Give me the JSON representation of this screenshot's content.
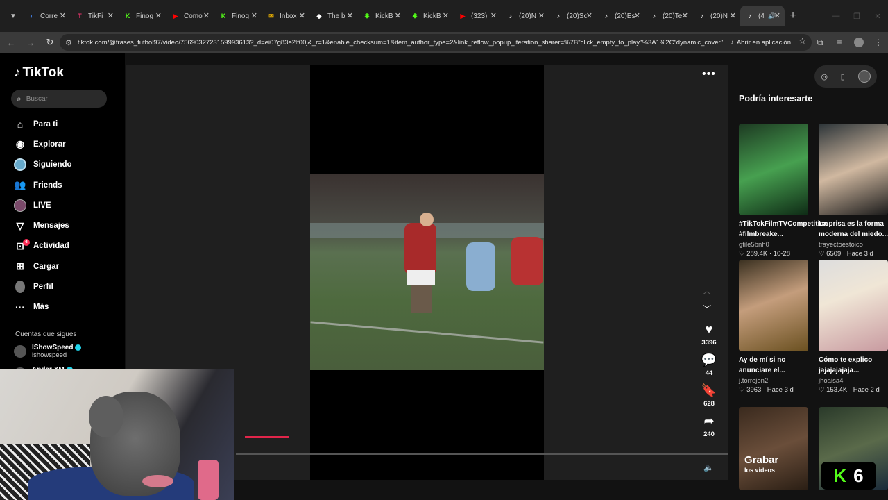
{
  "browser": {
    "tabs": [
      {
        "title": "Corre",
        "color": "#4285f4",
        "glyph": "◐"
      },
      {
        "title": "TikFi",
        "color": "#e8336b",
        "glyph": "T"
      },
      {
        "title": "Finog",
        "color": "#53fc18",
        "glyph": "K"
      },
      {
        "title": "Como",
        "color": "#ff0000",
        "glyph": "▶"
      },
      {
        "title": "Finog",
        "color": "#53fc18",
        "glyph": "K"
      },
      {
        "title": "Inbox",
        "color": "#f5b800",
        "glyph": "✉"
      },
      {
        "title": "The b",
        "color": "#ffffff",
        "glyph": "◆"
      },
      {
        "title": "KickB",
        "color": "#53fc18",
        "glyph": "✱"
      },
      {
        "title": "KickB",
        "color": "#53fc18",
        "glyph": "✱"
      },
      {
        "title": "(323)",
        "color": "#ff0000",
        "glyph": "▶"
      },
      {
        "title": "(20)N",
        "color": "#ffffff",
        "glyph": "♪"
      },
      {
        "title": "(20)Sc",
        "color": "#ffffff",
        "glyph": "♪"
      },
      {
        "title": "(20)Es",
        "color": "#ffffff",
        "glyph": "♪"
      },
      {
        "title": "(20)Te",
        "color": "#ffffff",
        "glyph": "♪"
      },
      {
        "title": "(20)N",
        "color": "#ffffff",
        "glyph": "♪"
      }
    ],
    "active_tab": {
      "title": "(4",
      "color": "#ffffff",
      "glyph": "♪"
    },
    "url": "tiktok.com/@frases_futbol97/video/7569032723159993613?_d=ei07g83e2lf00j&_r=1&enable_checksum=1&item_author_type=2&link_reflow_popup_iteration_sharer=%7B\"click_empty_to_play\"%3A1%2C\"dynamic_cover\"%...",
    "open_app": "Abrir en aplicación"
  },
  "sidebar": {
    "logo": "TikTok",
    "search_placeholder": "Buscar",
    "nav": [
      {
        "label": "Para ti",
        "icon": "home-icon"
      },
      {
        "label": "Explorar",
        "icon": "compass-icon"
      },
      {
        "label": "Siguiendo",
        "icon": "following-avatar-icon"
      },
      {
        "label": "Friends",
        "icon": "friends-icon"
      },
      {
        "label": "LIVE",
        "icon": "live-avatar-icon"
      },
      {
        "label": "Mensajes",
        "icon": "inbox-icon"
      },
      {
        "label": "Actividad",
        "icon": "activity-icon",
        "badge": "4"
      },
      {
        "label": "Cargar",
        "icon": "upload-icon"
      },
      {
        "label": "Perfil",
        "icon": "profile-icon"
      },
      {
        "label": "Más",
        "icon": "more-icon"
      }
    ],
    "following_header": "Cuentas que sigues",
    "following": [
      {
        "name": "IShowSpeed",
        "handle": "ishowspeed"
      },
      {
        "name": "Ander XM",
        "handle": ""
      }
    ]
  },
  "video": {
    "likes": "3396",
    "comments": "44",
    "saves": "628",
    "shares": "240"
  },
  "recommendations": {
    "title": "Podría interesarte",
    "cards": [
      {
        "desc": "#TikTokFilmTVCompetition #filmbreake...",
        "author": "gtile5bnh0",
        "likes": "289.4K",
        "date": "10-28"
      },
      {
        "desc": "La prisa es la forma moderna del miedo...",
        "author": "trayectoestoico",
        "likes": "6509",
        "date": "Hace 3 d"
      },
      {
        "desc": "Ay de mí si no anunciare el...",
        "author": "j.torrejon2",
        "likes": "3963",
        "date": "Hace 3 d"
      },
      {
        "desc": "Cómo te explico jajajajajaja...",
        "author": "jhoaisa4",
        "likes": "153.4K",
        "date": "Hace 2 d"
      },
      {
        "overlay_title": "Grabar",
        "overlay_sub": "los videos"
      },
      {
        "kick_number": "6"
      }
    ]
  }
}
